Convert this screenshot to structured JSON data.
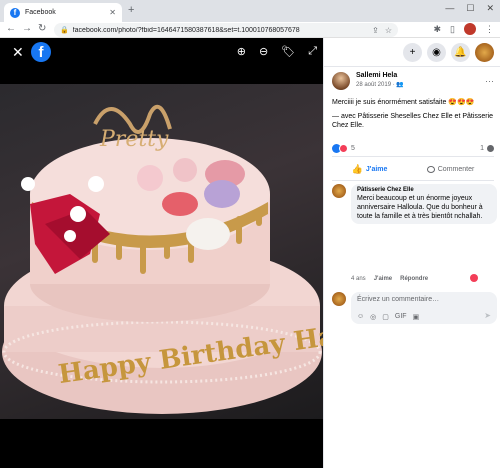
{
  "browser": {
    "tab_title": "Facebook",
    "tab_close": "✕",
    "new_tab": "+",
    "url": "facebook.com/photo/?fbid=1646471580387618&set=t.100010768057678",
    "window_controls": [
      "—",
      "☐",
      "✕"
    ]
  },
  "viewer": {
    "close": "✕",
    "logo": "f",
    "tools": [
      "⊕",
      "⊖",
      "🏷",
      "⤢"
    ],
    "cake_text": "Happy Birthday Halloula",
    "topper_text": "Pretty"
  },
  "panel": {
    "top_icons": [
      "+",
      "◉",
      "🔔"
    ],
    "post": {
      "author": "Sallemi Hela",
      "date": "28 août 2019 · ",
      "message": "Merciiii je suis énormément satisfaite 😍😍😍",
      "with_text": "— avec Pâtisserie Sheselles Chez Elle et Pâtisserie Chez Elle.",
      "more": "···",
      "reaction_count": "5",
      "comment_count": "1"
    },
    "actions": {
      "like": "J'aime",
      "comment": "Commenter"
    },
    "comment": {
      "author": "Pâtisserie Chez Elle",
      "text": "Merci beaucoup et un énorme joyeux anniversaire Halloula. Que du bonheur à toute la famille et à très bientôt nchallah.",
      "age": "4 ans",
      "like": "J'aime",
      "reply": "Répondre"
    },
    "composer": {
      "placeholder": "Écrivez un commentaire…",
      "icons": [
        "☺",
        "◎",
        "▢",
        "GIF",
        "▣"
      ],
      "send": "➤"
    }
  },
  "colors": {
    "facebook_blue": "#1877f2",
    "love_red": "#f33e58"
  }
}
